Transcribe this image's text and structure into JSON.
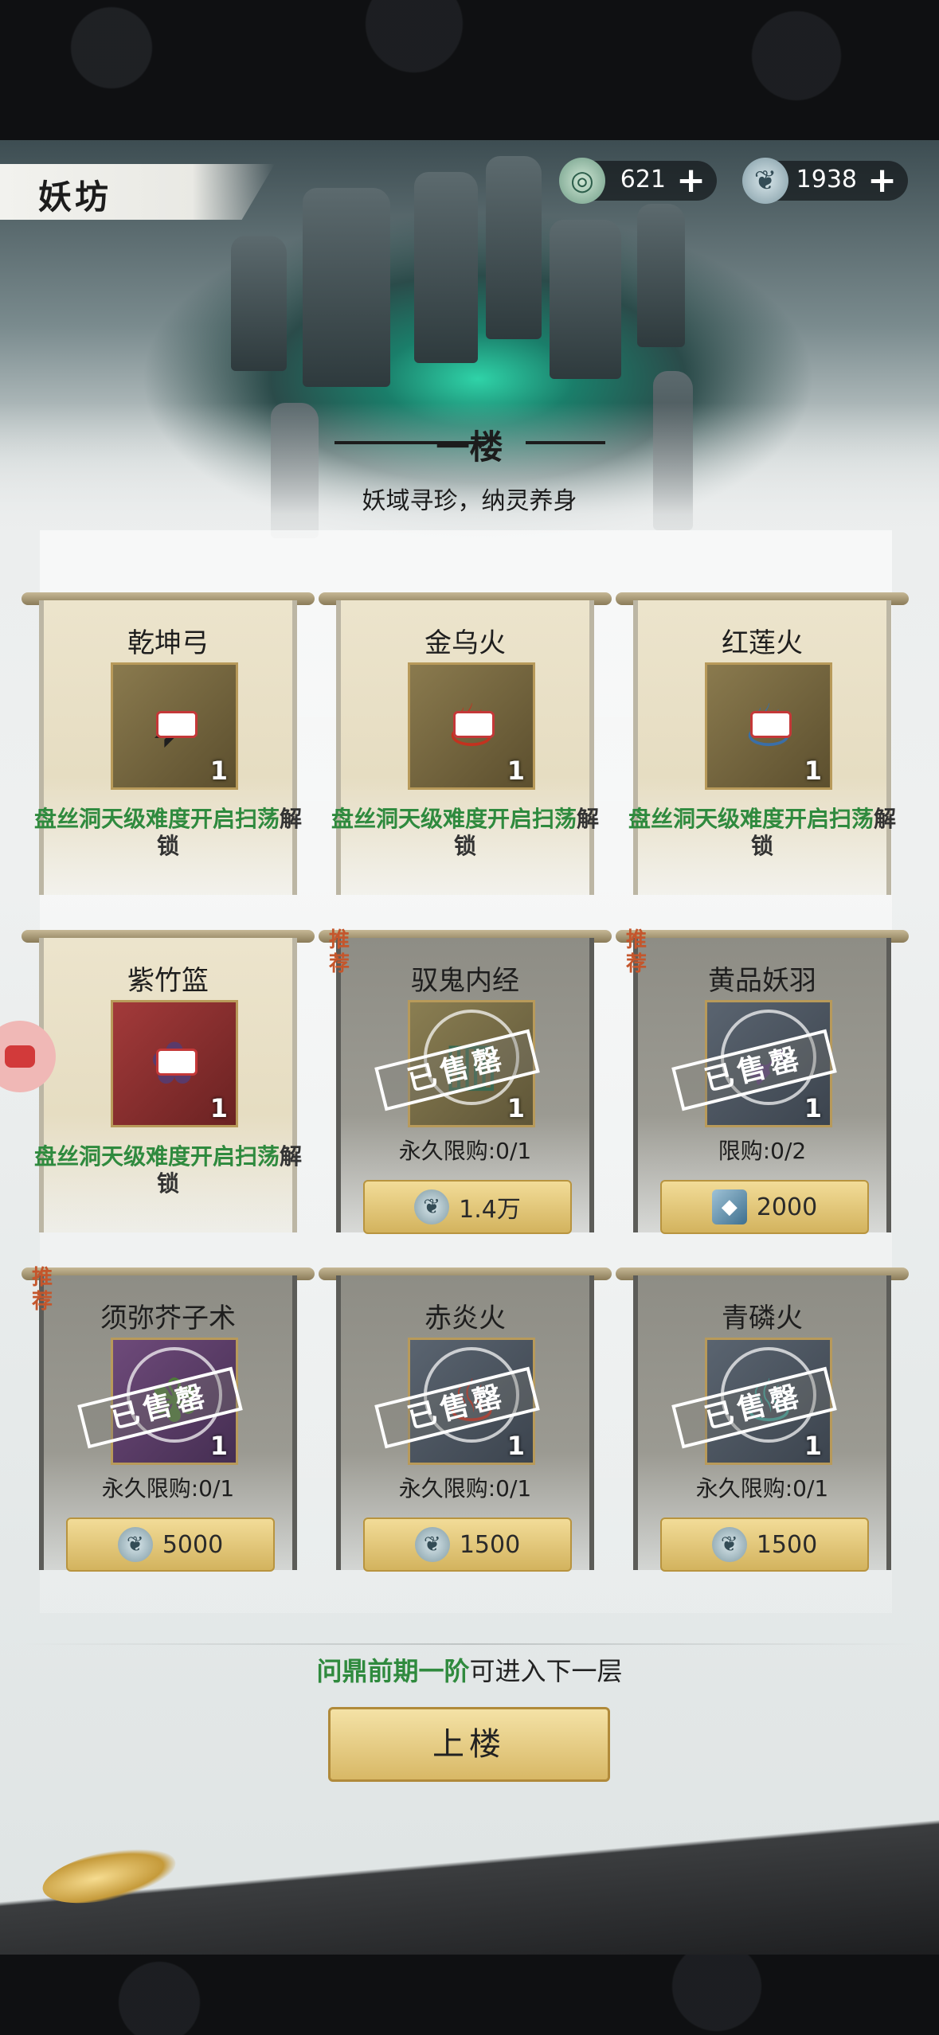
{
  "header": {
    "title": "妖坊"
  },
  "currency": [
    {
      "name": "jade-token-icon",
      "value": "621",
      "plus": "+"
    },
    {
      "name": "gourd-token-icon",
      "value": "1938",
      "plus": "+"
    }
  ],
  "floor": {
    "title": "一楼",
    "subtitle": "妖域寻珍，纳灵养身"
  },
  "items": [
    {
      "name": "乾坤弓",
      "qty": "1",
      "cond_green": "盘丝洞天级难度开启扫荡",
      "cond_dark": "解锁"
    },
    {
      "name": "金乌火",
      "qty": "1",
      "cond_green": "盘丝洞天级难度开启扫荡",
      "cond_dark": "解锁"
    },
    {
      "name": "红莲火",
      "qty": "1",
      "cond_green": "盘丝洞天级难度开启扫荡",
      "cond_dark": "解锁"
    },
    {
      "name": "紫竹篮",
      "qty": "1",
      "cond_green": "盘丝洞天级难度开启扫荡",
      "cond_dark": "解锁"
    },
    {
      "name": "驭鬼内经",
      "qty": "1",
      "badge": "推荐",
      "sold": "已售罄",
      "limit": "永久限购:0/1",
      "price": "1.4万"
    },
    {
      "name": "黄品妖羽",
      "qty": "1",
      "badge": "推荐",
      "sold": "已售罄",
      "limit": "限购:0/2",
      "price": "2000"
    },
    {
      "name": "须弥芥子术",
      "qty": "1",
      "badge": "推荐",
      "sold": "已售罄",
      "limit": "永久限购:0/1",
      "price": "5000"
    },
    {
      "name": "赤炎火",
      "qty": "1",
      "sold": "已售罄",
      "limit": "永久限购:0/1",
      "price": "1500"
    },
    {
      "name": "青磷火",
      "qty": "1",
      "sold": "已售罄",
      "limit": "永久限购:0/1",
      "price": "1500"
    }
  ],
  "footer": {
    "tip_green": "问鼎前期一阶",
    "tip_dark": "可进入下一层",
    "button": "上楼"
  }
}
